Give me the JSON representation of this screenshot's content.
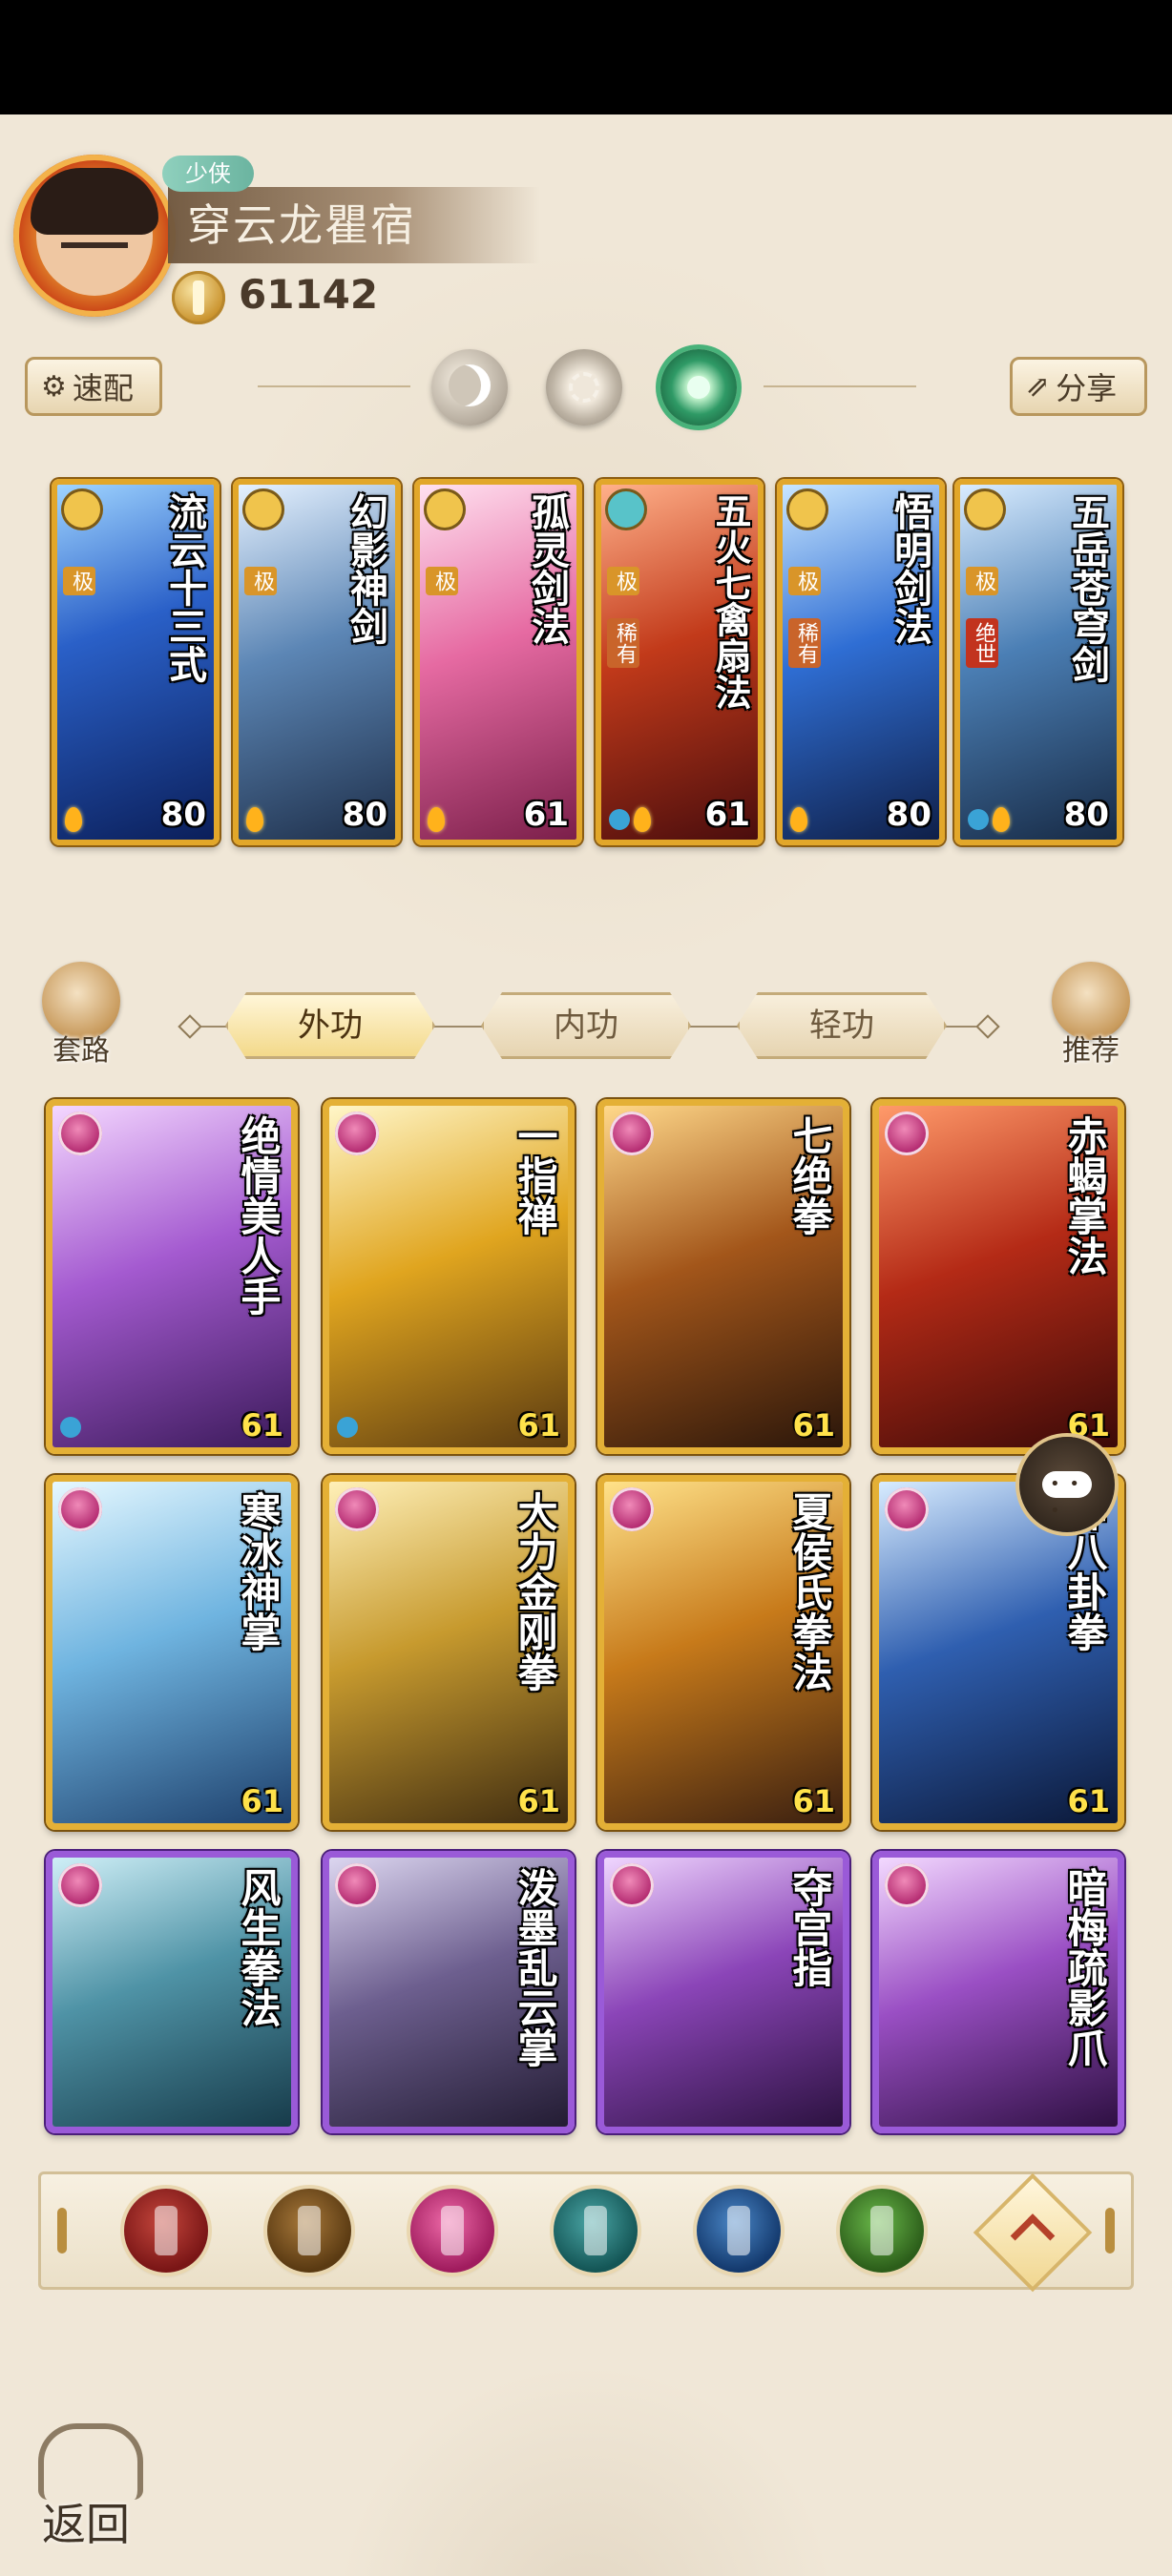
{
  "header": {
    "rank_badge": "少侠",
    "player_name": "穿云龙瞿宿",
    "power": "61142"
  },
  "toolbar": {
    "quick_label": "速配",
    "share_label": "分享",
    "mode_icons": [
      "moon-icon",
      "sun-icon",
      "leaf-icon"
    ],
    "selected_mode": "leaf-icon"
  },
  "equipped_skills": [
    {
      "title": "流云十三式",
      "level": "80",
      "tags": [
        "极"
      ],
      "elements": [
        "fire"
      ]
    },
    {
      "title": "幻影神剑",
      "level": "80",
      "tags": [
        "极"
      ],
      "elements": [
        "fire"
      ]
    },
    {
      "title": "孤灵剑法",
      "level": "61",
      "tags": [
        "极"
      ],
      "elements": [
        "fire"
      ]
    },
    {
      "title": "五火七禽扇法",
      "level": "61",
      "tags": [
        "极",
        "稀有"
      ],
      "elements": [
        "water",
        "fire"
      ]
    },
    {
      "title": "悟明剑法",
      "level": "80",
      "tags": [
        "极",
        "稀有"
      ],
      "elements": [
        "fire"
      ]
    },
    {
      "title": "五岳苍穹剑",
      "level": "80",
      "tags": [
        "极",
        "绝世"
      ],
      "elements": [
        "water",
        "fire"
      ]
    }
  ],
  "side_buttons": {
    "routes_label": "套路",
    "recommend_label": "推荐"
  },
  "tabs": [
    {
      "label": "外功",
      "active": true
    },
    {
      "label": "内功",
      "active": false
    },
    {
      "label": "轻功",
      "active": false
    }
  ],
  "martial_cards": [
    {
      "title": "绝情美人手",
      "level": "61",
      "frame": "gold",
      "water": true
    },
    {
      "title": "一指禅",
      "level": "61",
      "frame": "gold",
      "water": true
    },
    {
      "title": "七绝拳",
      "level": "61",
      "frame": "gold",
      "water": false
    },
    {
      "title": "赤蝎掌法",
      "level": "61",
      "frame": "gold",
      "water": false
    },
    {
      "title": "寒冰神掌",
      "level": "61",
      "frame": "gold",
      "water": false
    },
    {
      "title": "大力金刚拳",
      "level": "61",
      "frame": "gold",
      "water": false
    },
    {
      "title": "夏侯氏拳法",
      "level": "61",
      "frame": "gold",
      "water": false
    },
    {
      "title": "神八卦拳",
      "level": "61",
      "frame": "gold",
      "water": false
    },
    {
      "title": "风生拳法",
      "level": "",
      "frame": "purple",
      "water": false
    },
    {
      "title": "泼墨乱云掌",
      "level": "",
      "frame": "purple",
      "water": false
    },
    {
      "title": "夺宫指",
      "level": "",
      "frame": "purple",
      "water": false
    },
    {
      "title": "暗梅疏影爪",
      "level": "",
      "frame": "purple",
      "water": false
    }
  ],
  "filters": [
    {
      "name": "sword-filter-icon",
      "color": "#8a1f1f"
    },
    {
      "name": "blade-filter-icon",
      "color": "#6b4a1e"
    },
    {
      "name": "fist-filter-icon",
      "color": "#b8276e"
    },
    {
      "name": "fan-filter-icon",
      "color": "#1f6b6b"
    },
    {
      "name": "taiji-filter-icon",
      "color": "#1d4f8a"
    },
    {
      "name": "whip-filter-icon",
      "color": "#3f7a2a"
    }
  ],
  "footer": {
    "back_label": "返回"
  }
}
